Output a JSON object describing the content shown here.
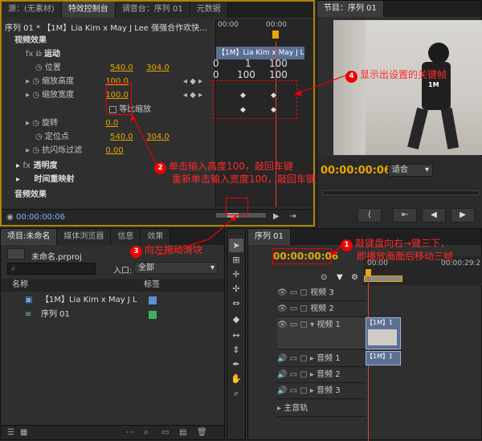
{
  "top_tabs": [
    "源：(无素材)",
    "特效控制台",
    "调音台：序列 01",
    "元数据"
  ],
  "program_tab": "节目：序列 01",
  "effect_controls": {
    "clip_header": "序列 01 * 【1M】Lia Kim x May J Lee 强强合作欢快…",
    "ruler": [
      "00:00",
      "00:00"
    ],
    "clip_bar": "【1M】Lia Kim x May J Lee",
    "video_effects": "视频效果",
    "motion": "运动",
    "position": {
      "label": "位置",
      "x": "540.0",
      "y": "304.0"
    },
    "scale_height": {
      "label": "缩放高度",
      "value": "100.0"
    },
    "scale_width": {
      "label": "缩放宽度",
      "value": "100.0"
    },
    "uniform_scale": "等比缩放",
    "rotation": {
      "label": "旋转",
      "value": "0.0"
    },
    "anchor": {
      "label": "定位点",
      "x": "540.0",
      "y": "304.0"
    },
    "antiflicker": {
      "label": "抗闪烁过滤",
      "value": "0.00"
    },
    "opacity": "透明度",
    "time_remap": "时间重映射",
    "audio_effects": "音频效果",
    "timecode": "00:00:00:06",
    "graph_top": [
      "0",
      "1",
      "100"
    ],
    "graph_mid": [
      "0",
      "100",
      "100"
    ]
  },
  "program": {
    "timecode": "00:00:00:06",
    "fit": "适合",
    "shirt": "1M"
  },
  "project": {
    "tabs": [
      "项目:未命名",
      "媒体浏览器",
      "信息",
      "效果"
    ],
    "file": "未命名.prproj",
    "entry_label": "入口:",
    "entry_value": "全部",
    "col_name": "名称",
    "col_label": "标签",
    "items": [
      {
        "name": "【1M】Lia Kim x May J Lee",
        "color": "#5b8fd6"
      },
      {
        "name": "序列 01",
        "color": "#3fb25f"
      }
    ]
  },
  "sequence": {
    "tab": "序列 01",
    "timecode": "00:00:00:06",
    "ruler": [
      "00:00",
      "00:00:29:2"
    ],
    "video_tracks": [
      "视频 3",
      "视频 2",
      "视频 1"
    ],
    "audio_tracks": [
      "音频 1",
      "音频 2",
      "音频 3"
    ],
    "master": "主音轨",
    "clip": "【1M】1"
  },
  "annotations": {
    "a1": {
      "num": "1",
      "line1": "敲键盘向右→键三下，",
      "line2": "即播放画面后移动三帧"
    },
    "a2": {
      "num": "2",
      "line1": "单击输入高度100，敲回车键",
      "line2": "重新单击输入宽度100，敲回车键"
    },
    "a3": {
      "num": "3",
      "text": "向左拖动滑块"
    },
    "a4": {
      "num": "4",
      "text": "显示出设置的关键帧"
    }
  },
  "colors": {
    "accent": "#e8a800",
    "annotation": "#e00000",
    "timeline_cursor": "#e04040"
  }
}
